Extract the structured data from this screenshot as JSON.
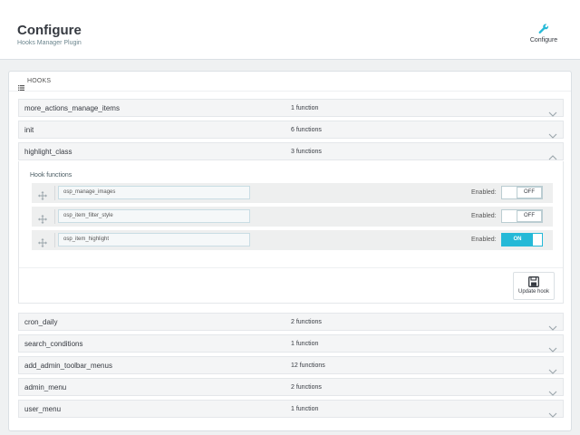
{
  "header": {
    "title": "Configure",
    "subtitle": "Hooks Manager Plugin",
    "configure_label": "Configure"
  },
  "panel": {
    "heading": "HOOKS"
  },
  "hooks": [
    {
      "name": "more_actions_manage_items",
      "count": "1 function"
    },
    {
      "name": "init",
      "count": "6 functions"
    },
    {
      "name": "highlight_class",
      "count": "3 functions"
    },
    {
      "name": "cron_daily",
      "count": "2 functions"
    },
    {
      "name": "search_conditions",
      "count": "1 function"
    },
    {
      "name": "add_admin_toolbar_menus",
      "count": "12 functions"
    },
    {
      "name": "admin_menu",
      "count": "2 functions"
    },
    {
      "name": "user_menu",
      "count": "1 function"
    }
  ],
  "expanded": {
    "label": "Hook functions",
    "enabled_label": "Enabled:",
    "functions": [
      {
        "name": "osp_manage_images",
        "state": "OFF"
      },
      {
        "name": "osp_item_filter_style",
        "state": "OFF"
      },
      {
        "name": "osp_item_highlight",
        "state": "ON"
      }
    ],
    "update_label": "Update hook"
  },
  "icons": {
    "configure": "wrench-icon",
    "list": "list-icon",
    "chevron": "chevron-down-icon",
    "drag": "move-arrows-icon",
    "save": "floppy-disk-icon"
  },
  "colors": {
    "accent": "#25b9d7",
    "text": "#363a41",
    "background": "#eff1f2"
  }
}
